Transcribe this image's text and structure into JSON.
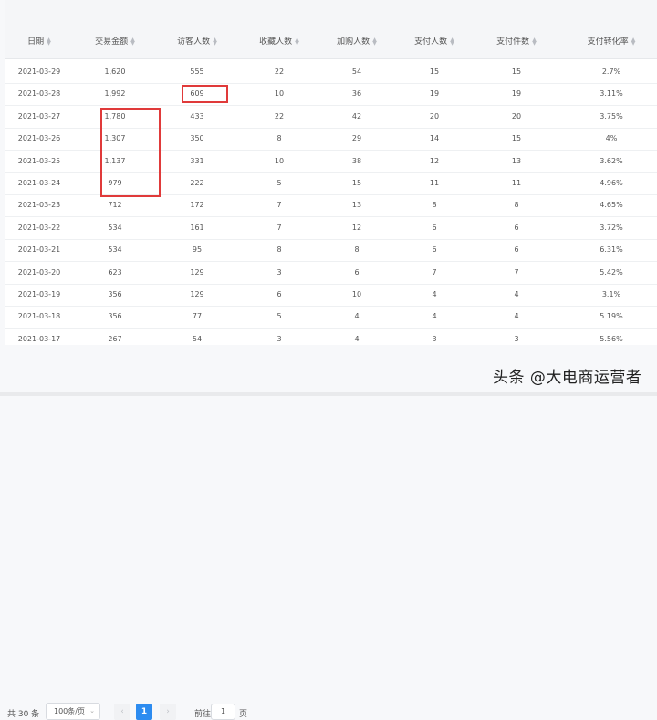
{
  "table": {
    "columns": [
      "日期",
      "交易金额",
      "访客人数",
      "收藏人数",
      "加购人数",
      "支付人数",
      "支付件数",
      "支付转化率"
    ],
    "rows": [
      [
        "2021-03-29",
        "1,620",
        "555",
        "22",
        "54",
        "15",
        "15",
        "2.7%"
      ],
      [
        "2021-03-28",
        "1,992",
        "609",
        "10",
        "36",
        "19",
        "19",
        "3.11%"
      ],
      [
        "2021-03-27",
        "1,780",
        "433",
        "22",
        "42",
        "20",
        "20",
        "3.75%"
      ],
      [
        "2021-03-26",
        "1,307",
        "350",
        "8",
        "29",
        "14",
        "15",
        "4%"
      ],
      [
        "2021-03-25",
        "1,137",
        "331",
        "10",
        "38",
        "12",
        "13",
        "3.62%"
      ],
      [
        "2021-03-24",
        "979",
        "222",
        "5",
        "15",
        "11",
        "11",
        "4.96%"
      ],
      [
        "2021-03-23",
        "712",
        "172",
        "7",
        "13",
        "8",
        "8",
        "4.65%"
      ],
      [
        "2021-03-22",
        "534",
        "161",
        "7",
        "12",
        "6",
        "6",
        "3.72%"
      ],
      [
        "2021-03-21",
        "534",
        "95",
        "8",
        "8",
        "6",
        "6",
        "6.31%"
      ],
      [
        "2021-03-20",
        "623",
        "129",
        "3",
        "6",
        "7",
        "7",
        "5.42%"
      ],
      [
        "2021-03-19",
        "356",
        "129",
        "6",
        "10",
        "4",
        "4",
        "3.1%"
      ],
      [
        "2021-03-18",
        "356",
        "77",
        "5",
        "4",
        "4",
        "4",
        "5.19%"
      ],
      [
        "2021-03-17",
        "267",
        "54",
        "3",
        "4",
        "3",
        "3",
        "5.56%"
      ]
    ]
  },
  "pagination": {
    "total": "共 30 条",
    "page_size": "100条/页",
    "prev_icon": "chevron-left-icon",
    "next_icon": "chevron-right-icon",
    "current_page": "1",
    "goto_label": "前往",
    "goto_value": "1",
    "page_unit": "页"
  },
  "watermark": "头条 @大电商运营者",
  "colors": {
    "highlight": "#e03a3a",
    "accent": "#2d8cf0"
  }
}
